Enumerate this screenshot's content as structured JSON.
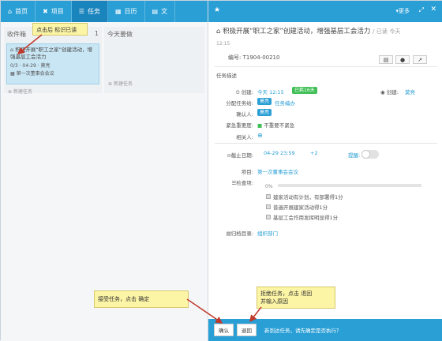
{
  "topnav": {
    "tabs": [
      {
        "label": "首页",
        "icon": "home-icon"
      },
      {
        "label": "项目",
        "icon": "grid-icon"
      },
      {
        "label": "任务",
        "icon": "list-icon"
      },
      {
        "label": "日历",
        "icon": "calendar-icon"
      },
      {
        "label": "文",
        "icon": "doc-icon"
      }
    ]
  },
  "left": {
    "col1": {
      "title": "收件箱",
      "count": "1",
      "add": "新建任务"
    },
    "col2": {
      "title": "今天要做",
      "add": "新建任务"
    },
    "card": {
      "title": "积极开展“职工之家”创建活动，增强基层工会活力",
      "meta": "0/3 · 04-29 · 莫亮",
      "project": "第一次董事会会议"
    }
  },
  "right": {
    "header": {
      "more": "更多"
    },
    "title": "积极开展“职工之家”创建活动，增强基层工会活力",
    "state": "/ 已读",
    "state_time": "今天",
    "time_line": "12:15",
    "code": "编号: T1904-00210",
    "desc_label": "任务描述",
    "created_label": "创建:",
    "created_value": "今天 12:15",
    "created_badge": "已耗16天",
    "creator_label": "创建:",
    "creator_value": "莫亮",
    "assignee_label": "分配任务给:",
    "assignee_value": "莫亮",
    "assignee_extra": "任务编办",
    "confirmer_label": "确认人:",
    "confirmer_value": "莫亮",
    "priority_label": "紧急重要度:",
    "priority_value": "不重要不紧急",
    "related_label": "相关人:",
    "deadline_label": "截止日期:",
    "deadline_value": "04-29 23:59",
    "deadline_extra": "+2",
    "remind_label": "提醒:",
    "project_label": "项目:",
    "project_value": "第一次董事会会议",
    "checklist_label": "检查项:",
    "progress": "0%",
    "checklist": [
      "建家活动有计划，有部署得1分",
      "普遍开展建家活动得1分",
      "基层工会作用发挥明显得1分"
    ],
    "archive_label": "归档目录:",
    "archive_value": "组织部门"
  },
  "bottom": {
    "confirm": "确认",
    "reject": "退回",
    "message": "新到达任务，请先确定是否执行？"
  },
  "callouts": {
    "c1": "点击后  标识已读",
    "c2": "接受任务，点击  确定",
    "c3": "拒绝任务，点击  退回\n并输入原因"
  }
}
